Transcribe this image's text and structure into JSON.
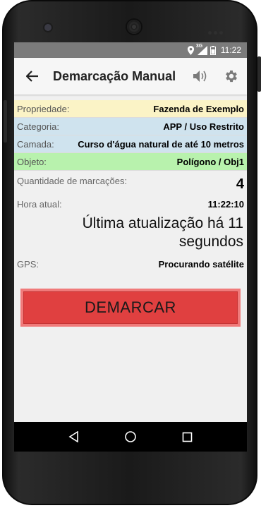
{
  "status_bar": {
    "network_type": "3G",
    "time": "11:22",
    "icons": [
      "location-icon",
      "signal-icon",
      "battery-icon"
    ]
  },
  "app_bar": {
    "title": "Demarcação Manual",
    "actions": [
      "volume-icon",
      "gear-icon"
    ]
  },
  "info_rows": {
    "propriedade": {
      "label": "Propriedade:",
      "value": "Fazenda de Exemplo",
      "color": "#fbf3c6"
    },
    "categoria": {
      "label": "Categoria:",
      "value": "APP / Uso Restrito",
      "color": "#cfe3ee"
    },
    "camada": {
      "label": "Camada:",
      "value": "Curso d'água natural de até 10 metros",
      "color": "#cfe3ee"
    },
    "objeto": {
      "label": "Objeto:",
      "value": "Polígono / Obj1",
      "color": "#b8f2ad"
    }
  },
  "quantidade": {
    "label": "Quantidade de marcações:",
    "value": "4"
  },
  "hora": {
    "label": "Hora atual:",
    "value": "11:22:10"
  },
  "last_update": "Última atualização há 11 segundos",
  "gps": {
    "label": "GPS:",
    "value": "Procurando satélite"
  },
  "demarcar_button": {
    "label": "DEMARCAR",
    "color": "#e04040"
  },
  "nav_bar": [
    "back-triangle-icon",
    "home-circle-icon",
    "recents-square-icon"
  ]
}
